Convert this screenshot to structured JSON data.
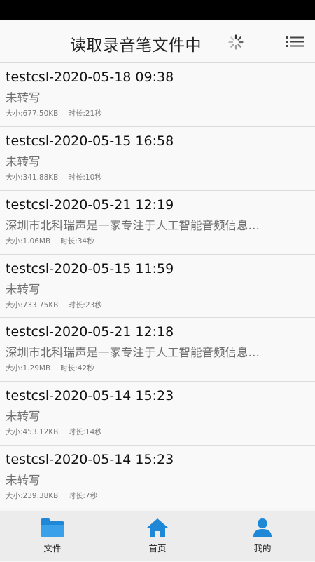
{
  "header": {
    "title": "读取录音笔文件中"
  },
  "recordings": [
    {
      "title": "testcsl-2020-05-18 09:38",
      "preview": "未转写",
      "size": "大小:677.50KB",
      "duration": "时长:21秒"
    },
    {
      "title": "testcsl-2020-05-15 16:58",
      "preview": "未转写",
      "size": "大小:341.88KB",
      "duration": "时长:10秒"
    },
    {
      "title": "testcsl-2020-05-21 12:19",
      "preview": "深圳市北科瑞声是一家专注于人工智能音频信息…",
      "size": "大小:1.06MB",
      "duration": "时长:34秒"
    },
    {
      "title": "testcsl-2020-05-15 11:59",
      "preview": "未转写",
      "size": "大小:733.75KB",
      "duration": "时长:23秒"
    },
    {
      "title": "testcsl-2020-05-21 12:18",
      "preview": "深圳市北科瑞声是一家专注于人工智能音频信息…",
      "size": "大小:1.29MB",
      "duration": "时长:42秒"
    },
    {
      "title": "testcsl-2020-05-14 15:23",
      "preview": "未转写",
      "size": "大小:453.12KB",
      "duration": "时长:14秒"
    },
    {
      "title": "testcsl-2020-05-14 15:23",
      "preview": "未转写",
      "size": "大小:239.38KB",
      "duration": "时长:7秒"
    }
  ],
  "tabs": [
    {
      "label": "文件",
      "icon": "folder-icon"
    },
    {
      "label": "首页",
      "icon": "home-icon"
    },
    {
      "label": "我的",
      "icon": "person-icon"
    }
  ],
  "colors": {
    "accent": "#1e88d6"
  }
}
